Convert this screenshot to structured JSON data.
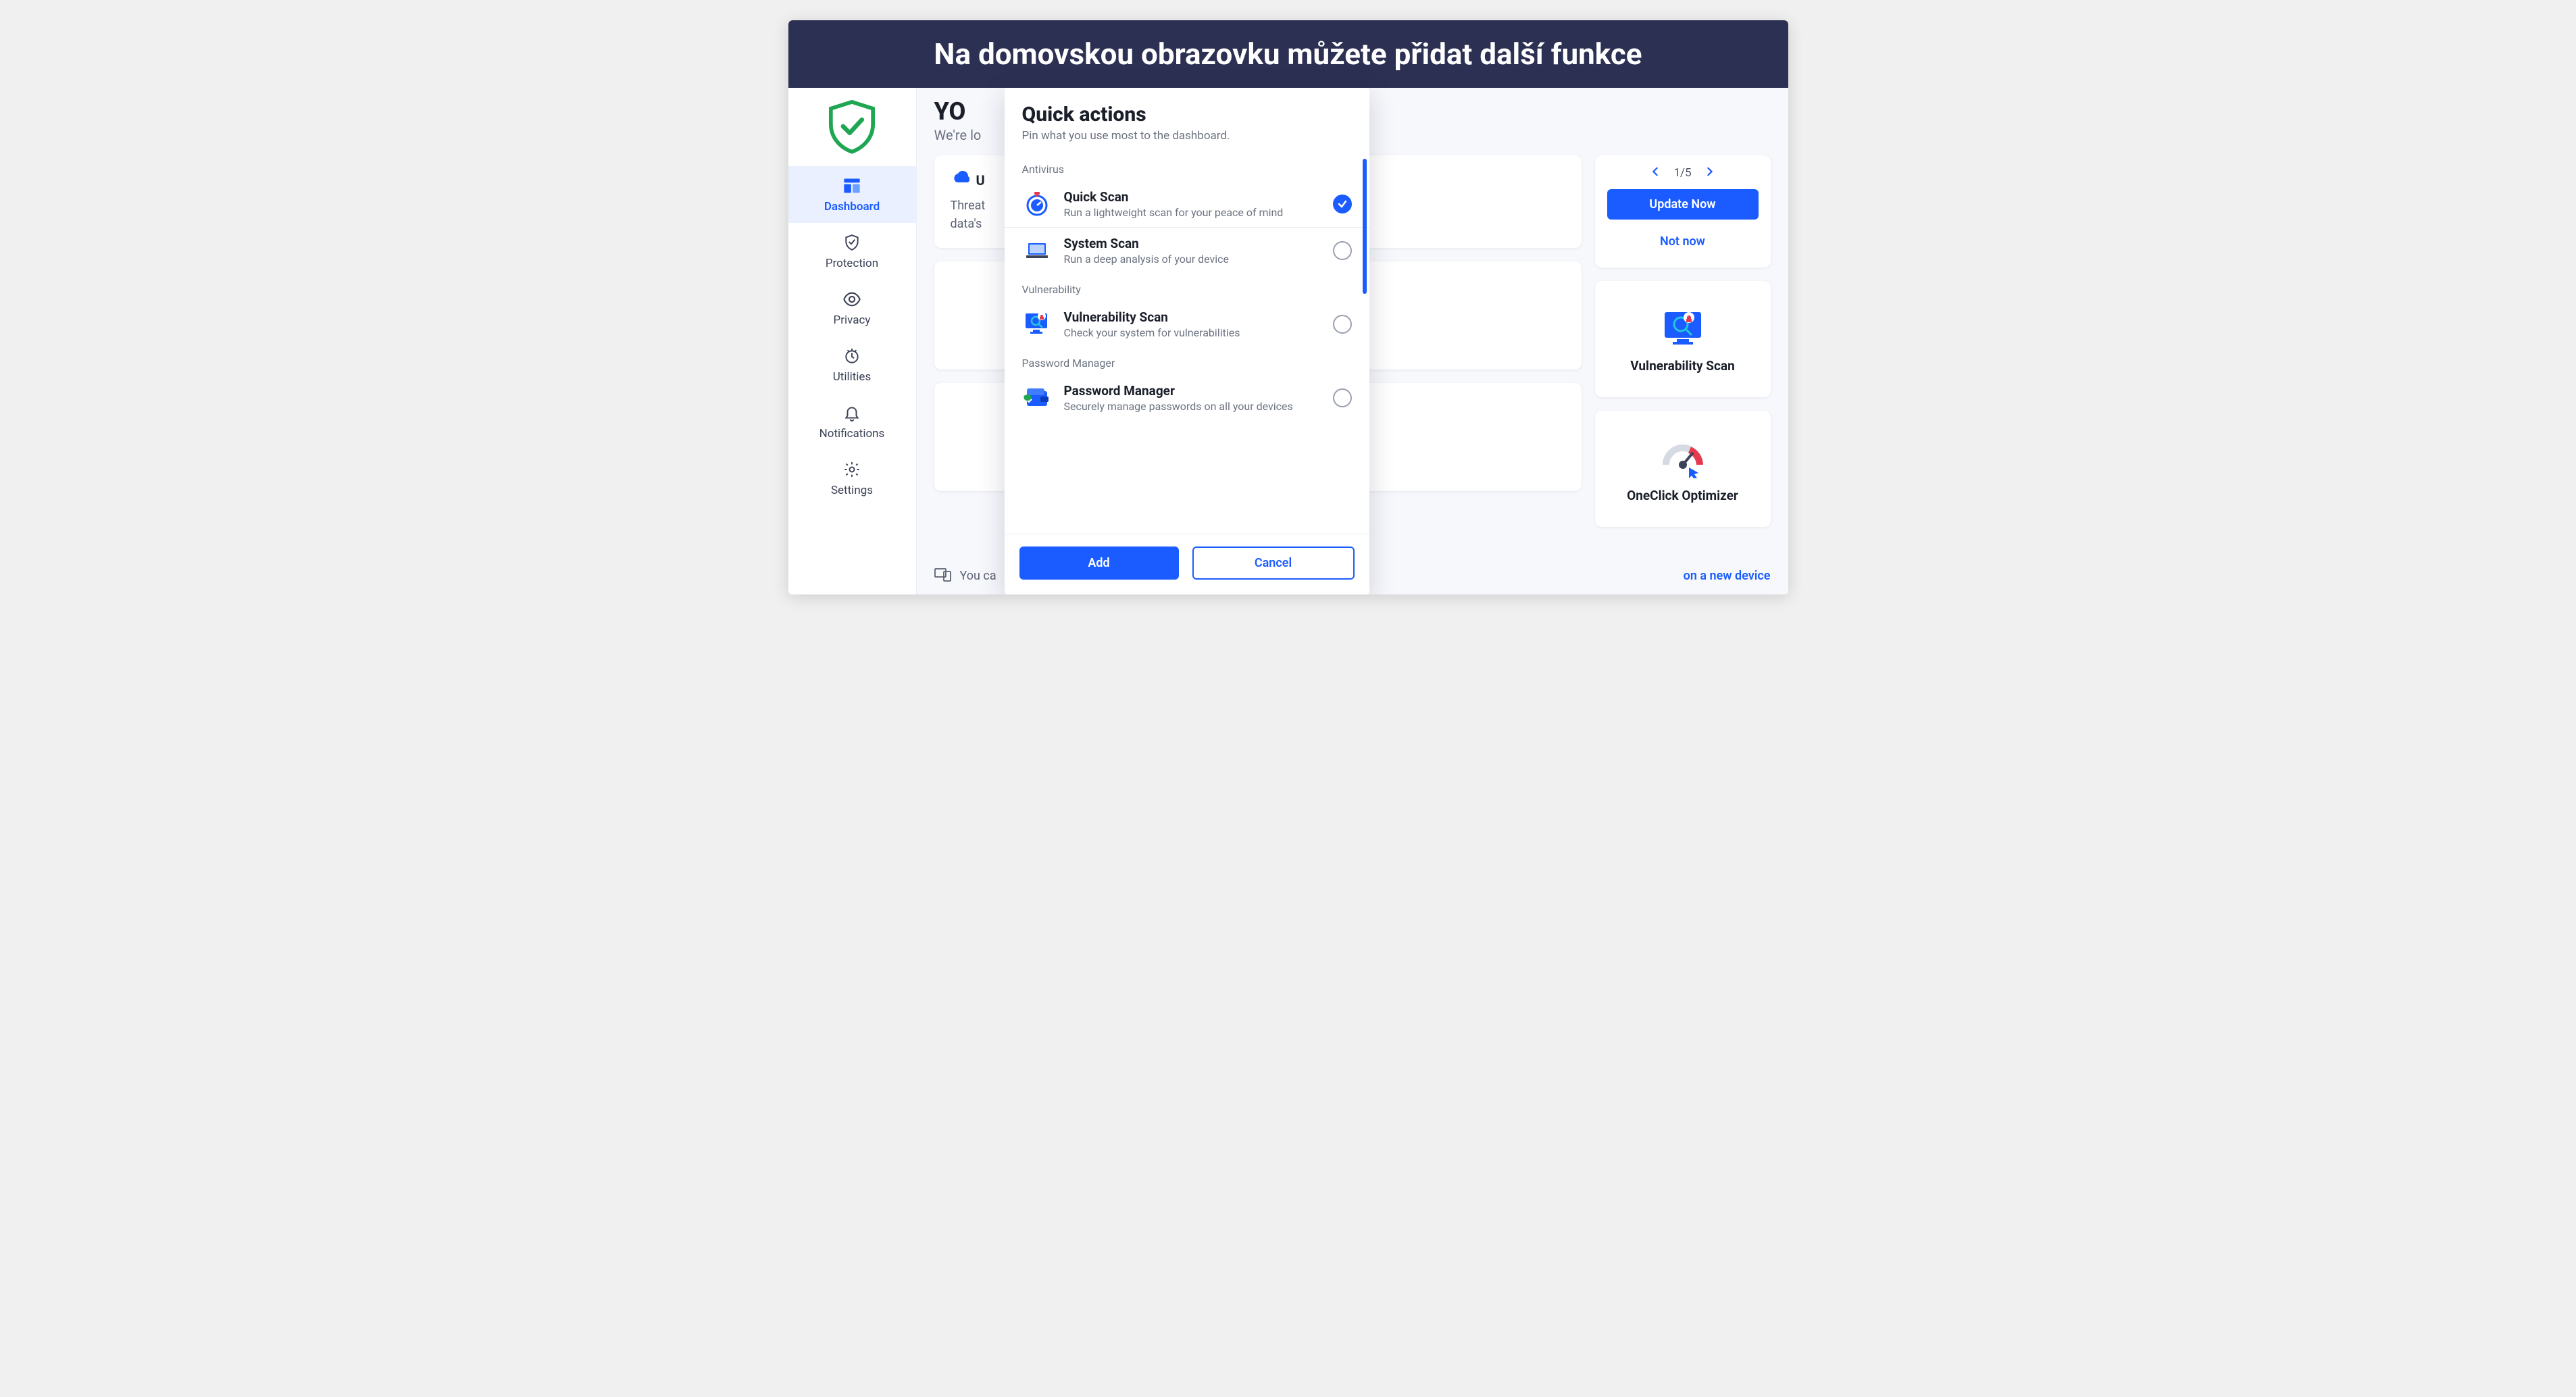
{
  "banner": "Na domovskou obrazovku můžete přidat další funkce",
  "header": {
    "title": "YO",
    "subtitle": "We're lo"
  },
  "sidebar": {
    "items": [
      {
        "label": "Dashboard"
      },
      {
        "label": "Protection"
      },
      {
        "label": "Privacy"
      },
      {
        "label": "Utilities"
      },
      {
        "label": "Notifications"
      },
      {
        "label": "Settings"
      }
    ]
  },
  "cards": {
    "update": {
      "title_fragment": "U",
      "desc_line1": "Threat",
      "desc_line2": "data's"
    }
  },
  "right": {
    "pager": "1/5",
    "update_now": "Update Now",
    "not_now": "Not now",
    "tile1": "Vulnerability Scan",
    "tile2": "OneClick Optimizer"
  },
  "footer": {
    "lead": "You ca",
    "end": "on a new device"
  },
  "modal": {
    "title": "Quick actions",
    "subtitle": "Pin what you use most to the dashboard.",
    "sections": {
      "antivirus": {
        "label": "Antivirus",
        "quick_scan": {
          "title": "Quick Scan",
          "desc": "Run a lightweight scan for your peace of mind"
        },
        "system_scan": {
          "title": "System Scan",
          "desc": "Run a deep analysis of your device"
        }
      },
      "vulnerability": {
        "label": "Vulnerability",
        "vuln_scan": {
          "title": "Vulnerability Scan",
          "desc": "Check your system for vulnerabilities"
        }
      },
      "password": {
        "label": "Password Manager",
        "pm": {
          "title": "Password Manager",
          "desc": "Securely manage passwords on all your devices"
        }
      }
    },
    "add": "Add",
    "cancel": "Cancel"
  }
}
